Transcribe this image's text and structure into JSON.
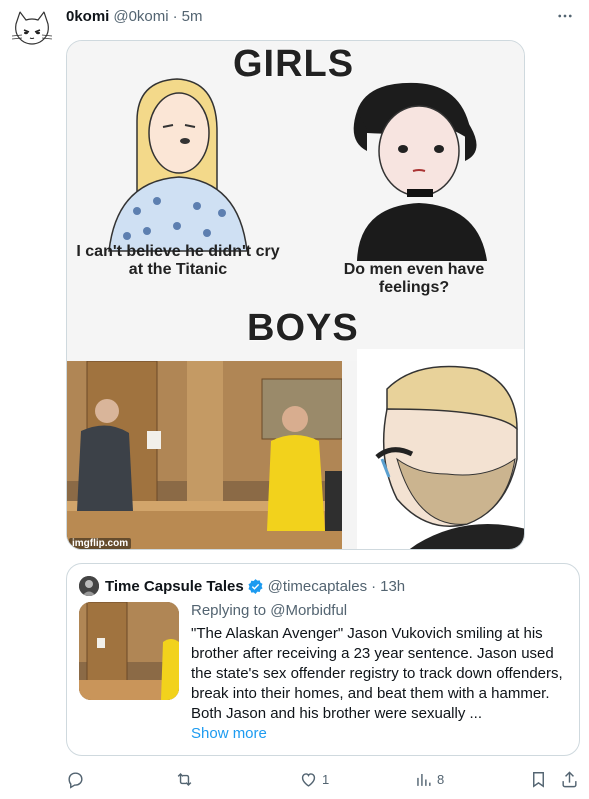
{
  "tweet": {
    "author_name": "0komi",
    "author_handle": "@0komi",
    "separator": "·",
    "time": "5m"
  },
  "meme": {
    "top_heading": "GIRLS",
    "bottom_heading": "BOYS",
    "caption_left": "I can't believe he didn't cry at the Titanic",
    "caption_right": "Do men even have feelings?",
    "watermark": "imgflip.com"
  },
  "quote": {
    "author_name": "Time Capsule Tales",
    "author_handle": "@timecaptales",
    "separator": "·",
    "time": "13h",
    "replying_prefix": "Replying to",
    "replying_to": "@Morbidful",
    "text": "\"The Alaskan Avenger\" Jason Vukovich smiling at his brother after receiving a 23 year sentence. Jason used the state's sex offender registry to track down offenders, break into their homes, and beat them with a hammer. Both Jason and his brother were sexually ...",
    "show_more": "Show more"
  },
  "actions": {
    "reply_count": "",
    "repost_count": "",
    "like_count": "1",
    "views_count": "8"
  },
  "colors": {
    "accent": "#1d9bf0",
    "muted": "#536471",
    "border": "#cfd9de",
    "verified": "#1d9bf0"
  }
}
